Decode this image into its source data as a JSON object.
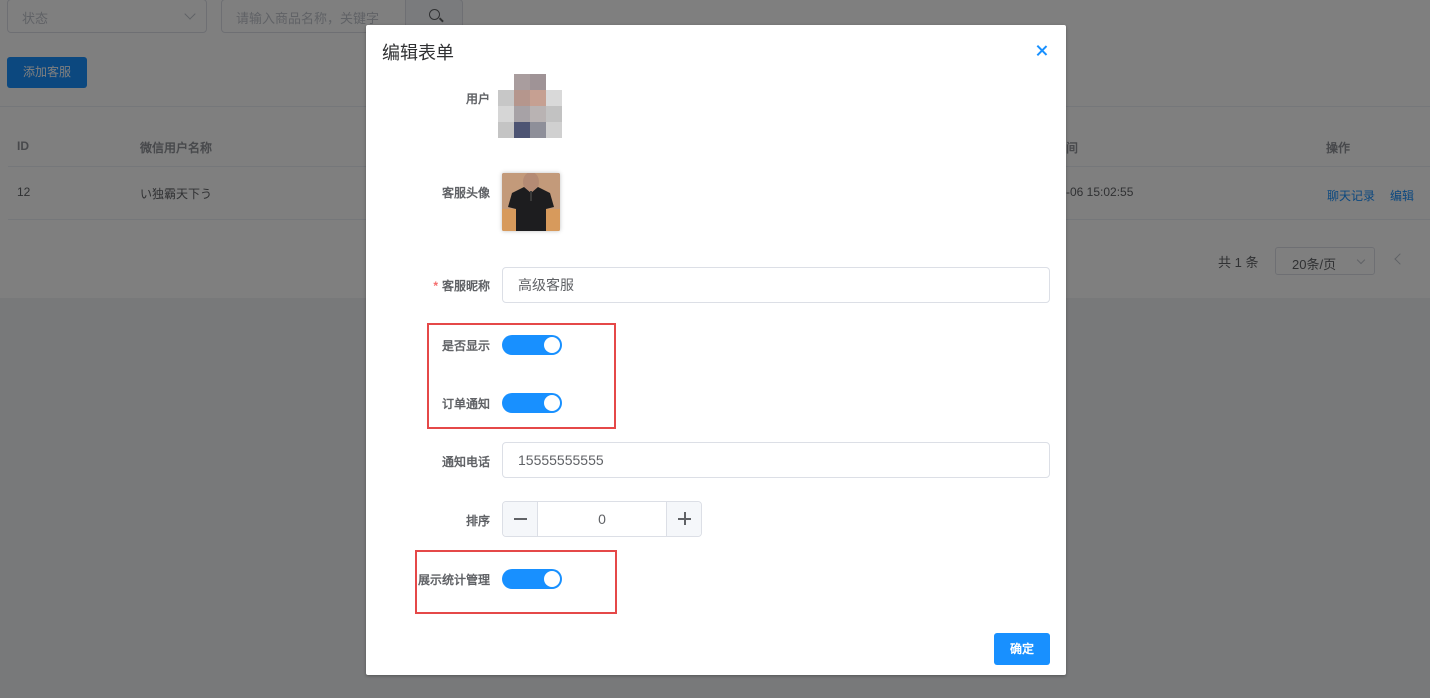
{
  "background": {
    "filter_status_placeholder": "状态",
    "filter_search_placeholder": "请输入商品名称，关键字",
    "add_button_label": "添加客服",
    "table": {
      "headers": [
        "ID",
        "微信用户名称",
        "间",
        "操作"
      ],
      "row": {
        "id": "12",
        "wechat_name": "い独霸天下う",
        "time": "-06 15:02:55",
        "chat_log_link": "聊天记录",
        "edit_link": "编辑"
      }
    },
    "pager": {
      "total": "共 1 条",
      "page_size": "20条/页"
    }
  },
  "dialog": {
    "title": "编辑表单",
    "labels": {
      "user": "用户",
      "avatar": "客服头像",
      "nickname_required": "*",
      "nickname": "客服昵称",
      "show": "是否显示",
      "order_notice": "订单通知",
      "phone": "通知电话",
      "sort": "排序",
      "stats": "展示统计管理"
    },
    "values": {
      "nickname": "高级客服",
      "phone": "15555555555",
      "sort": "0",
      "show": true,
      "order_notice": true,
      "stats": true
    },
    "confirm_label": "确定"
  },
  "colors": {
    "primary": "#1890ff",
    "highlight_box": "#e54848",
    "required": "#f56c6c"
  }
}
